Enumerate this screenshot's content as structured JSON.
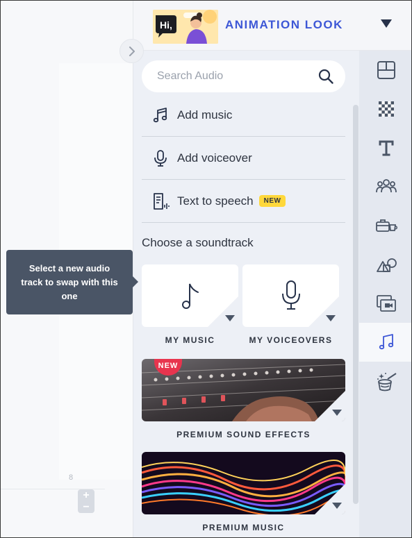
{
  "tooltip": {
    "text": "Select a new audio track to swap with this one"
  },
  "canvas": {
    "ruler_number": "8",
    "zoom_in": "+",
    "zoom_out": "−"
  },
  "header": {
    "theme_title": "ANIMATION LOOK",
    "thumb_text": "Hi,"
  },
  "search": {
    "placeholder": "Search Audio",
    "value": ""
  },
  "menu": {
    "add_music": "Add music",
    "add_voiceover": "Add voiceover",
    "text_to_speech": "Text to speech",
    "new_badge": "NEW"
  },
  "soundtrack": {
    "heading": "Choose a soundtrack",
    "my_music": "MY MUSIC",
    "my_voiceovers": "MY VOICEOVERS",
    "premium_sfx": "PREMIUM SOUND EFFECTS",
    "premium_sfx_badge": "NEW",
    "premium_music": "PREMIUM MUSIC"
  },
  "rail": {
    "items": [
      "layout-icon",
      "background-icon",
      "text-icon",
      "characters-icon",
      "props-icon",
      "shapes-icon",
      "media-icon",
      "music-note-icon",
      "magic-hat-icon"
    ],
    "active": "music-note-icon"
  },
  "colors": {
    "accent": "#3d57d6",
    "tooltip_bg": "#4a5566",
    "badge_yellow": "#ffd83b",
    "badge_red": "#e8344e"
  }
}
